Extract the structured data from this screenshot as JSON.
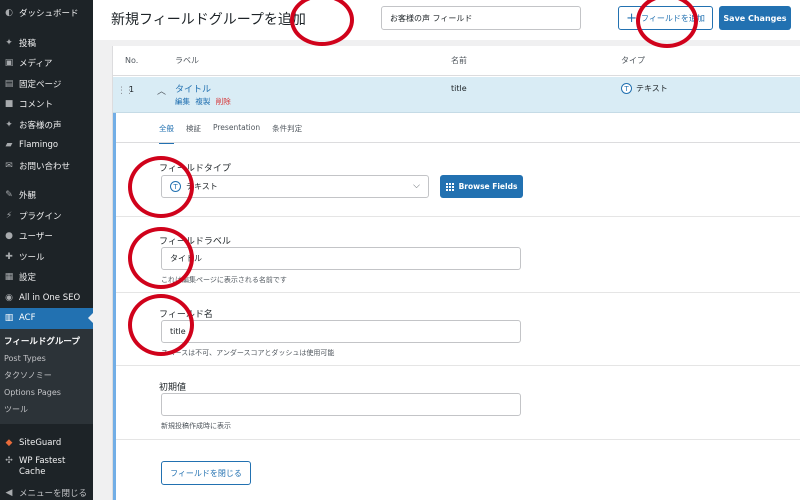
{
  "sidebar": {
    "items": [
      {
        "label": "ダッシュボード",
        "icon": "dashboard-icon"
      },
      {
        "label": "投稿",
        "icon": "pin-icon"
      },
      {
        "label": "メディア",
        "icon": "media-icon"
      },
      {
        "label": "固定ページ",
        "icon": "page-icon"
      },
      {
        "label": "コメント",
        "icon": "comment-icon"
      },
      {
        "label": "お客様の声",
        "icon": "pin-icon"
      },
      {
        "label": "Flamingo",
        "icon": "flamingo-icon"
      },
      {
        "label": "お問い合わせ",
        "icon": "mail-icon"
      },
      {
        "label": "外観",
        "icon": "brush-icon"
      },
      {
        "label": "プラグイン",
        "icon": "plugin-icon"
      },
      {
        "label": "ユーザー",
        "icon": "user-icon"
      },
      {
        "label": "ツール",
        "icon": "wrench-icon"
      },
      {
        "label": "設定",
        "icon": "settings-icon"
      },
      {
        "label": "All in One SEO",
        "icon": "seo-icon"
      },
      {
        "label": "ACF",
        "icon": "acf-icon"
      }
    ],
    "submenu": [
      "フィールドグループ",
      "Post Types",
      "タクソノミー",
      "Options Pages",
      "ツール"
    ],
    "bottom": [
      {
        "label": "SiteGuard",
        "icon": "siteguard-icon"
      },
      {
        "label": "WP Fastest Cache",
        "icon": "cache-icon"
      },
      {
        "label": "メニューを閉じる",
        "icon": "collapse-icon"
      }
    ]
  },
  "header": {
    "title": "新規フィールドグループを追加",
    "group_title_value": "お客様の声 フィールド",
    "add_field_label": "フィールドを追加",
    "save_label": "Save Changes"
  },
  "table": {
    "columns": [
      "No.",
      "ラベル",
      "名前",
      "タイプ"
    ],
    "row": {
      "no": "1",
      "label": "タイトル",
      "actions": [
        "編集",
        "複製",
        "削除"
      ],
      "name": "title",
      "type": "テキスト"
    }
  },
  "tabs": [
    "全般",
    "検証",
    "Presentation",
    "条件判定"
  ],
  "form": {
    "field_type": {
      "label": "フィールドタイプ",
      "value": "テキスト",
      "browse_label": "Browse Fields"
    },
    "field_label": {
      "label": "フィールドラベル",
      "value": "タイトル",
      "help": "これは編集ページに表示される名前です"
    },
    "field_name": {
      "label": "フィールド名",
      "value": "title",
      "help": "スペースは不可、アンダースコアとダッシュは使用可能"
    },
    "default_value": {
      "label": "初期値",
      "value": "",
      "help": "新規投稿作成時に表示"
    },
    "close_label": "フィールドを閉じる"
  },
  "colors": {
    "accent": "#2271b1",
    "sidebar": "#1d2327",
    "annotation": "#d0021b"
  }
}
